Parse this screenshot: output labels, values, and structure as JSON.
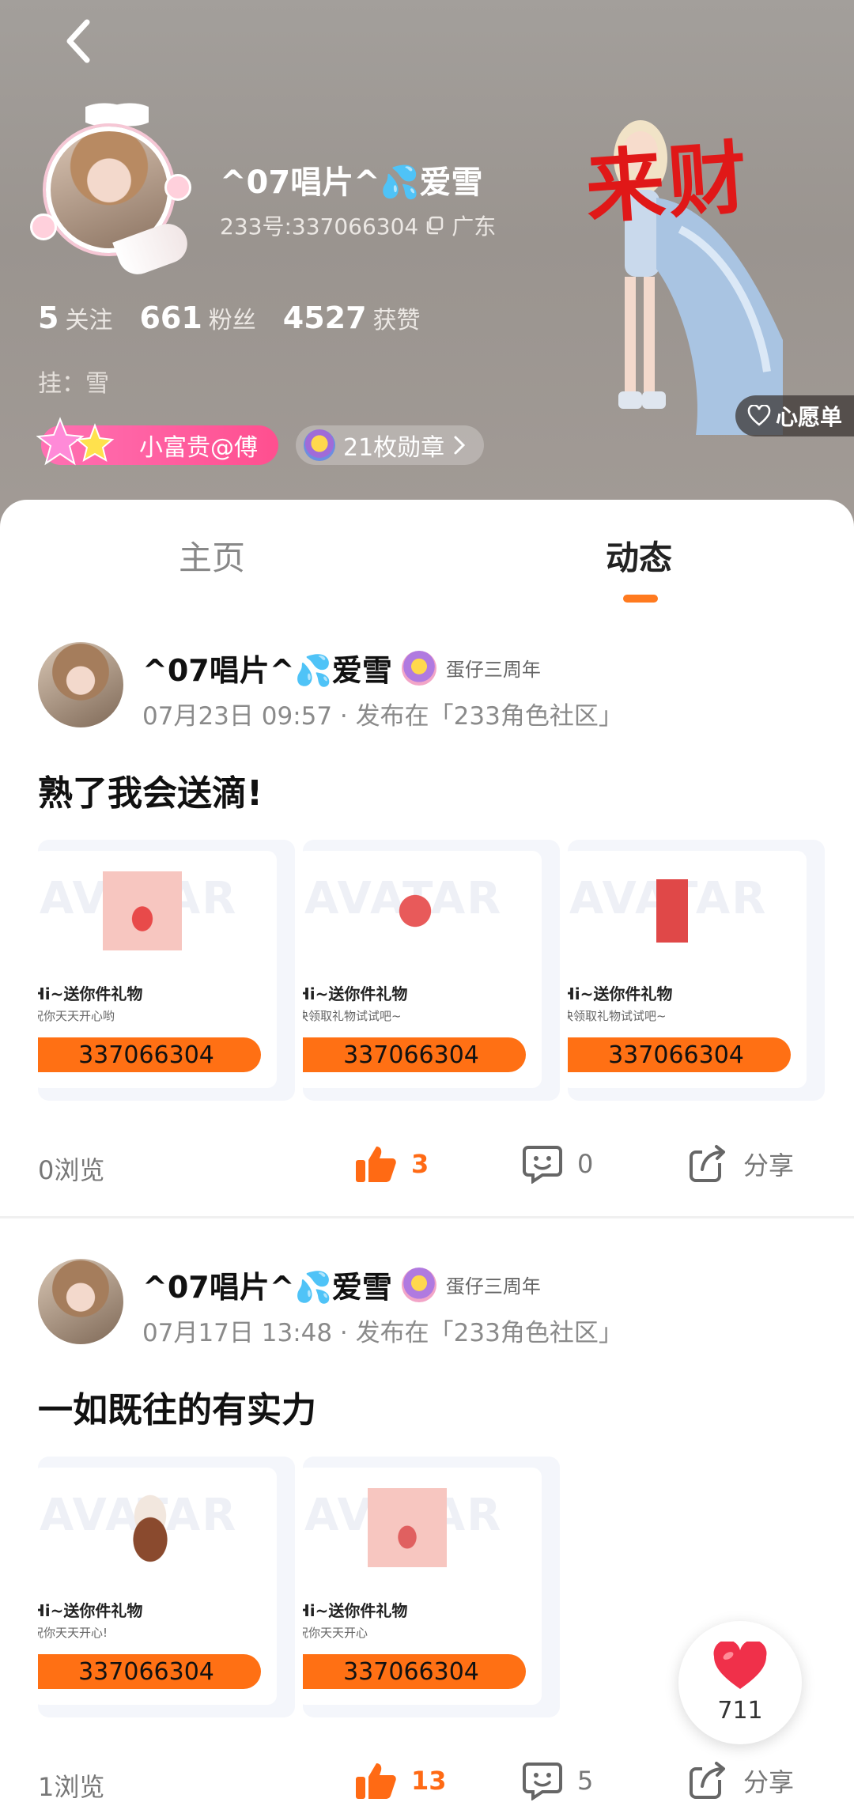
{
  "header": {
    "name": "^07唱片^💦爱雪",
    "id_label": "233号:337066304",
    "region": "广东",
    "stats": [
      {
        "value": "5",
        "label": "关注"
      },
      {
        "value": "661",
        "label": "粉丝"
      },
      {
        "value": "4527",
        "label": "获赞"
      }
    ],
    "signature": "挂：雪",
    "vip_label": "小富贵@傅",
    "medal_label": "21枚勋章",
    "character_text": "来财",
    "wishlist_label": "心愿单"
  },
  "tabs": [
    {
      "label": "主页",
      "active": false
    },
    {
      "label": "动态",
      "active": true
    }
  ],
  "posts": [
    {
      "author": "^07唱片^💦爱雪",
      "badge": "蛋仔三周年",
      "time": "07月23日 09:57 · 发布在「233角色社区」",
      "text": "熟了我会送滴!",
      "cards": [
        {
          "title": "Hi~送你件礼物",
          "sub": "祝你天天开心哟",
          "id": "337066304"
        },
        {
          "title": "Hi~送你件礼物",
          "sub": "快领取礼物试试吧~",
          "id": "337066304"
        },
        {
          "title": "Hi~送你件礼物",
          "sub": "快领取礼物试试吧~",
          "id": "337066304"
        }
      ],
      "views": "0浏览",
      "likes": "3",
      "comments": "0",
      "share": "分享"
    },
    {
      "author": "^07唱片^💦爱雪",
      "badge": "蛋仔三周年",
      "time": "07月17日 13:48 · 发布在「233角色社区」",
      "text": "一如既往的有实力",
      "cards": [
        {
          "title": "Hi~送你件礼物",
          "sub": "祝你天天开心!",
          "id": "337066304"
        },
        {
          "title": "Hi~送你件礼物",
          "sub": "祝你天天开心",
          "id": "337066304"
        }
      ],
      "views": "1浏览",
      "likes": "13",
      "comments": "5",
      "share": "分享"
    }
  ],
  "float_like_count": "711",
  "colors": {
    "accent": "#ff7a1f",
    "like": "#ff6a14",
    "vip": "#ff4f8f",
    "heart": "#f0304a"
  }
}
